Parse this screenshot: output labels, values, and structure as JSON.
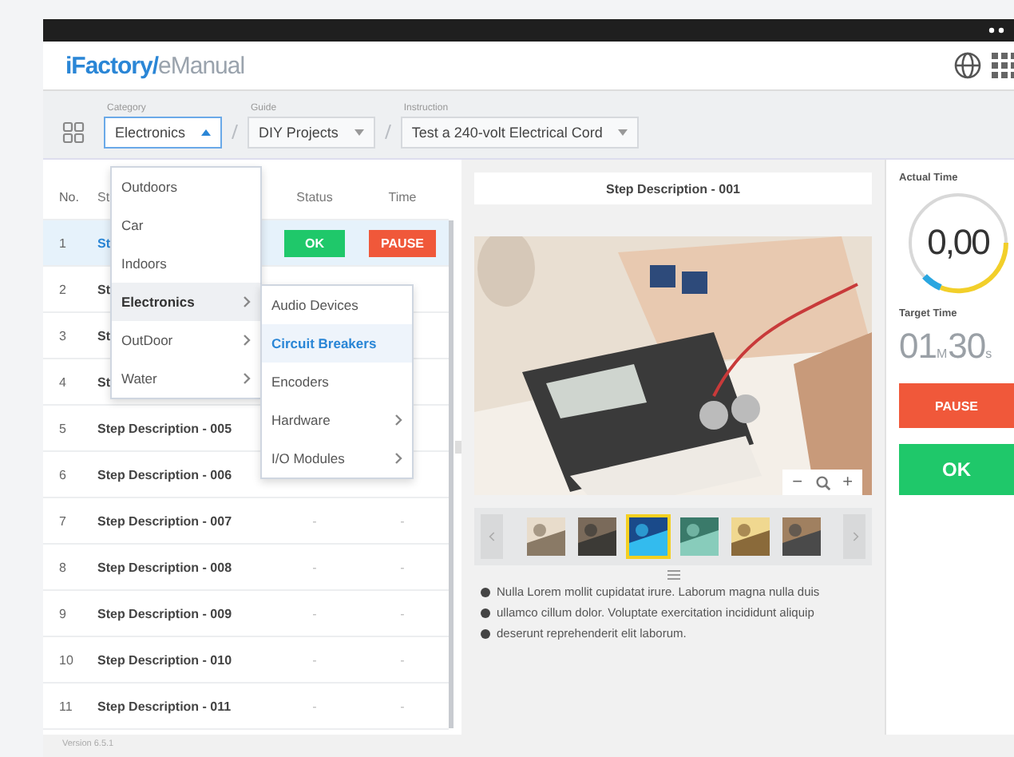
{
  "header": {
    "logo": {
      "brand": "iFactory/",
      "product": "eManual"
    }
  },
  "filters": [
    {
      "label": "Category",
      "value": "Electronics",
      "open": true
    },
    {
      "label": "Guide",
      "value": "DIY Projects",
      "open": false
    },
    {
      "label": "Instruction",
      "value": "Test a 240-volt Electrical Cord",
      "open": false
    }
  ],
  "table": {
    "columns": [
      "No.",
      "St",
      "Status",
      "Time"
    ],
    "rows": [
      {
        "no": "1",
        "step": "St",
        "selected": true,
        "status": {
          "text": "OK",
          "kind": "ok"
        },
        "time": {
          "text": "PAUSE",
          "kind": "pause"
        }
      },
      {
        "no": "2",
        "step": "St",
        "selected": false
      },
      {
        "no": "3",
        "step": "St",
        "selected": false
      },
      {
        "no": "4",
        "step": "St",
        "selected": false
      },
      {
        "no": "5",
        "step": "Step Description - 005",
        "selected": false
      },
      {
        "no": "6",
        "step": "Step Description - 006",
        "selected": false
      },
      {
        "no": "7",
        "step": "Step Description - 007",
        "selected": false,
        "status": {
          "text": "-",
          "kind": "plain"
        },
        "time": {
          "text": "-",
          "kind": "plain"
        }
      },
      {
        "no": "8",
        "step": "Step Description - 008",
        "selected": false,
        "status": {
          "text": "-",
          "kind": "plain"
        },
        "time": {
          "text": "-",
          "kind": "plain"
        }
      },
      {
        "no": "9",
        "step": "Step Description - 009",
        "selected": false,
        "status": {
          "text": "-",
          "kind": "plain"
        },
        "time": {
          "text": "-",
          "kind": "plain"
        }
      },
      {
        "no": "10",
        "step": "Step Description - 010",
        "selected": false,
        "status": {
          "text": "-",
          "kind": "plain"
        },
        "time": {
          "text": "-",
          "kind": "plain"
        }
      },
      {
        "no": "11",
        "step": "Step Description - 011",
        "selected": false,
        "status": {
          "text": "-",
          "kind": "plain"
        },
        "time": {
          "text": "-",
          "kind": "plain"
        }
      }
    ]
  },
  "category_menu": {
    "items": [
      {
        "label": "Outdoors",
        "selected": false,
        "has_children": false
      },
      {
        "label": "Car",
        "selected": false,
        "has_children": false
      },
      {
        "label": "Indoors",
        "selected": false,
        "has_children": false
      },
      {
        "label": "Electronics",
        "selected": true,
        "has_children": true
      },
      {
        "label": "OutDoor",
        "selected": false,
        "has_children": true
      },
      {
        "label": "Water",
        "selected": false,
        "has_children": true
      }
    ],
    "submenu": [
      {
        "label": "Audio Devices",
        "selected": false,
        "has_children": false
      },
      {
        "label": "Circuit Breakers",
        "selected": true,
        "has_children": false
      },
      {
        "label": "Encoders",
        "selected": false,
        "has_children": false
      },
      {
        "label": "Hardware",
        "selected": false,
        "has_children": true
      },
      {
        "label": "I/O Modules",
        "selected": false,
        "has_children": true
      }
    ]
  },
  "step_view": {
    "title": "Step Description - 001",
    "zoom_out": "−",
    "zoom_in": "+",
    "thumbnails": [
      {
        "selected": false
      },
      {
        "selected": false
      },
      {
        "selected": true
      },
      {
        "selected": false
      },
      {
        "selected": false
      },
      {
        "selected": false
      }
    ],
    "bullets": [
      "Nulla Lorem mollit cupidatat irure. Laborum magna nulla duis",
      "ullamco cillum dolor. Voluptate exercitation incididunt aliquip",
      "deserunt reprehenderit elit laborum."
    ]
  },
  "timer": {
    "actual_label": "Actual Time",
    "actual": "0,00",
    "target_label": "Target Time",
    "target": [
      {
        "value": "01",
        "unit": "M"
      },
      {
        "value": "30",
        "unit": "s"
      }
    ],
    "buttons": [
      {
        "label": "PAUSE",
        "kind": "pause"
      },
      {
        "label": "OK",
        "kind": "ok"
      }
    ]
  },
  "footer": {
    "version": "Version 6.5.1"
  }
}
